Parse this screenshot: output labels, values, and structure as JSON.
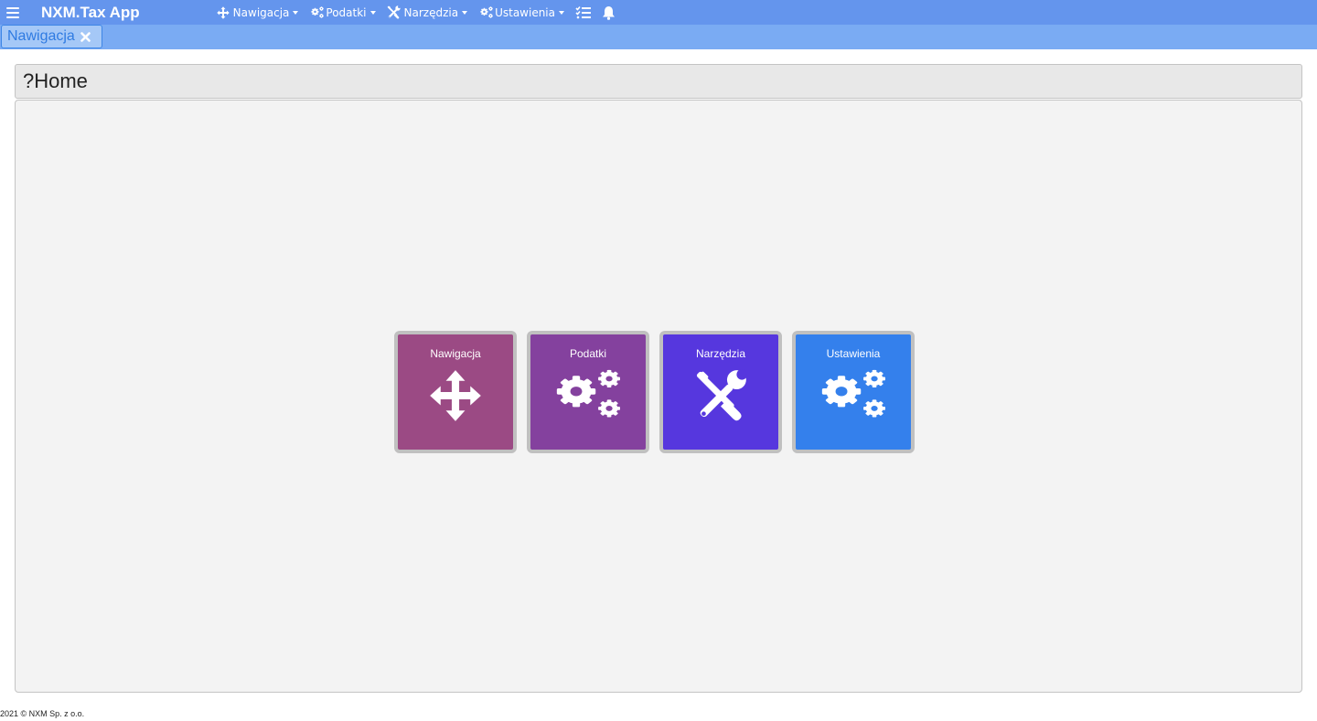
{
  "app": {
    "title": "NXM.Tax App"
  },
  "navbar": {
    "menu_icon": "hamburger-icon",
    "items": [
      {
        "label": "Nawigacja",
        "icon": "move-arrows-icon"
      },
      {
        "label": "Podatki",
        "icon": "cogs-icon"
      },
      {
        "label": "Narzędzia",
        "icon": "tools-icon"
      },
      {
        "label": "Ustawienia",
        "icon": "cogs-icon"
      }
    ],
    "extra_icons": [
      "tasks-list-icon",
      "bell-icon"
    ]
  },
  "tabs": [
    {
      "label": "Nawigacja",
      "close_icon": "close-icon"
    }
  ],
  "page": {
    "title": "?Home"
  },
  "tiles": [
    {
      "label": "Nawigacja",
      "icon": "move-arrows-icon",
      "color": "#9b4a84"
    },
    {
      "label": "Podatki",
      "icon": "cogs-icon",
      "color": "#84419e"
    },
    {
      "label": "Narzędzia",
      "icon": "tools-icon",
      "color": "#5637de"
    },
    {
      "label": "Ustawienia",
      "icon": "cogs-icon",
      "color": "#3480ec"
    }
  ],
  "colors": {
    "navbar": "#6495ed",
    "tabbar": "#7aabf3",
    "tab_text": "#2f7be2"
  },
  "footer": {
    "text": "2021 © NXM Sp. z o.o."
  }
}
